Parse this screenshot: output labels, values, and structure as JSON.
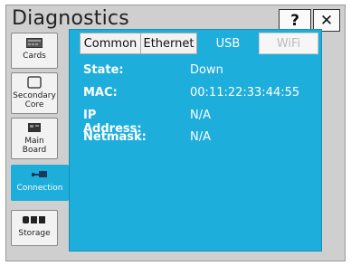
{
  "window": {
    "title": "Diagnostics",
    "help_label": "?",
    "close_label": "✕"
  },
  "sidebar": {
    "items": [
      {
        "label": "Cards",
        "icon": "card-icon"
      },
      {
        "label": "Secondary Core",
        "icon": "square-icon"
      },
      {
        "label": "Main Board",
        "icon": "board-icon"
      },
      {
        "label": "Connection",
        "icon": "connection-icon",
        "active": true
      },
      {
        "label": "Storage",
        "icon": "storage-icon"
      }
    ]
  },
  "tabs": [
    {
      "label": "Common"
    },
    {
      "label": "Ethernet"
    },
    {
      "label": "USB",
      "active": true
    },
    {
      "label": "WiFi",
      "disabled": true
    }
  ],
  "details": {
    "rows": [
      {
        "label": "State:",
        "value": "Down"
      },
      {
        "label": "MAC:",
        "value": "00:11:22:33:44:55"
      },
      {
        "label": "IP Address:",
        "value": "N/A"
      },
      {
        "label": "Netmask:",
        "value": "N/A"
      }
    ]
  },
  "colors": {
    "accent": "#1eaedb",
    "frame": "#cfcfcf"
  }
}
